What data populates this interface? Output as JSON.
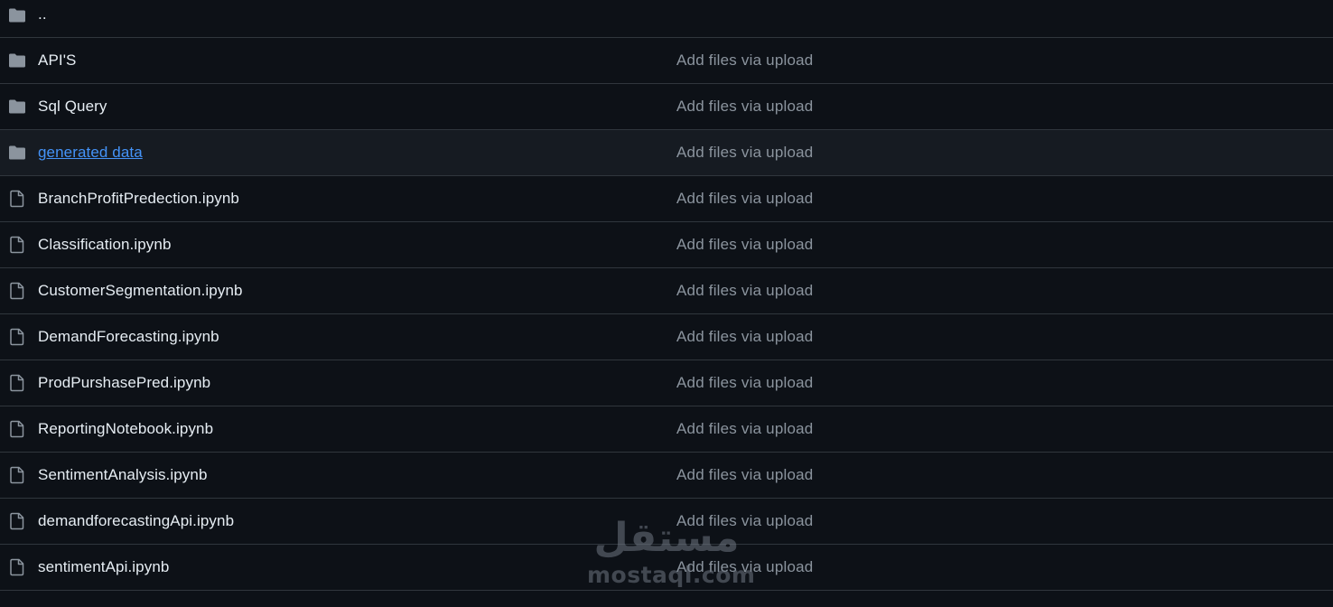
{
  "colors": {
    "background": "#0d1117",
    "row_border": "#30363d",
    "highlight_row": "#161b22",
    "text": "#e6edf3",
    "muted_text": "#8b949e",
    "link": "#4493f8",
    "icon": "#8b949e"
  },
  "parent_dir": {
    "label": "..",
    "icon": "folder-icon"
  },
  "entries": [
    {
      "name": "API'S",
      "type": "folder",
      "commit_message": "Add files via upload"
    },
    {
      "name": "Sql Query",
      "type": "folder",
      "commit_message": "Add files via upload"
    },
    {
      "name": "generated data",
      "type": "folder",
      "commit_message": "Add files via upload",
      "hovered": true
    },
    {
      "name": "BranchProfitPredection.ipynb",
      "type": "file",
      "commit_message": "Add files via upload"
    },
    {
      "name": "Classification.ipynb",
      "type": "file",
      "commit_message": "Add files via upload"
    },
    {
      "name": "CustomerSegmentation.ipynb",
      "type": "file",
      "commit_message": "Add files via upload"
    },
    {
      "name": "DemandForecasting.ipynb",
      "type": "file",
      "commit_message": "Add files via upload"
    },
    {
      "name": "ProdPurshasePred.ipynb",
      "type": "file",
      "commit_message": "Add files via upload"
    },
    {
      "name": "ReportingNotebook.ipynb",
      "type": "file",
      "commit_message": "Add files via upload"
    },
    {
      "name": "SentimentAnalysis.ipynb",
      "type": "file",
      "commit_message": "Add files via upload"
    },
    {
      "name": "demandforecastingApi.ipynb",
      "type": "file",
      "commit_message": "Add files via upload"
    },
    {
      "name": "sentimentApi.ipynb",
      "type": "file",
      "commit_message": "Add files via upload"
    }
  ],
  "watermark": {
    "arabic": "مستقل",
    "latin": "mostaql.com"
  }
}
